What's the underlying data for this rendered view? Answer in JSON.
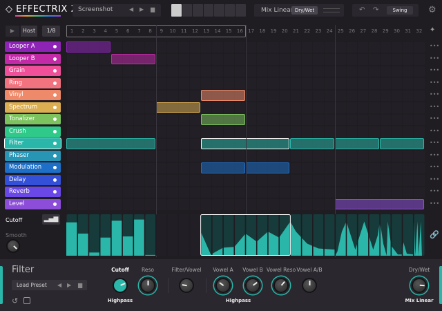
{
  "header": {
    "logo": "EFFECTRIX 2",
    "preset_name": "Screenshot",
    "mix_mode": "Mix Linear",
    "dry_wet_button": "Dry/Wet",
    "swing_button": "Swing"
  },
  "transport": {
    "play_icon": "play-icon",
    "sync": "Host",
    "rate": "1/8",
    "steps": [
      "1",
      "2",
      "3",
      "4",
      "5",
      "6",
      "7",
      "8",
      "9",
      "10",
      "11",
      "12",
      "13",
      "14",
      "15",
      "16",
      "17",
      "18",
      "19",
      "20",
      "21",
      "22",
      "23",
      "24",
      "25",
      "26",
      "27",
      "28",
      "29",
      "30",
      "31",
      "32"
    ],
    "loop_range": [
      1,
      16
    ]
  },
  "tracks": [
    {
      "name": "Looper A",
      "color": "#8e24b5",
      "blocks": [
        [
          1,
          4
        ]
      ]
    },
    {
      "name": "Looper B",
      "color": "#c22aa8",
      "blocks": [
        [
          5,
          8
        ]
      ]
    },
    {
      "name": "Grain",
      "color": "#f0509a",
      "blocks": []
    },
    {
      "name": "Ring",
      "color": "#f0737f",
      "blocks": []
    },
    {
      "name": "Vinyl",
      "color": "#ee8a6a",
      "blocks": [
        [
          13,
          16
        ]
      ]
    },
    {
      "name": "Spectrum",
      "color": "#dcae52",
      "blocks": [
        [
          9,
          12
        ]
      ]
    },
    {
      "name": "Tonalizer",
      "color": "#7cc25e",
      "blocks": [
        [
          13,
          16
        ]
      ]
    },
    {
      "name": "Crush",
      "color": "#2fc98a",
      "blocks": []
    },
    {
      "name": "Filter",
      "color": "#2ab7a9",
      "selected": true,
      "blocks": [
        [
          1,
          8
        ],
        [
          13,
          20
        ],
        [
          21,
          24
        ],
        [
          25,
          28
        ],
        [
          29,
          32
        ]
      ],
      "selected_block": 1
    },
    {
      "name": "Phaser",
      "color": "#2895b4",
      "blocks": []
    },
    {
      "name": "Modulation",
      "color": "#1d6fc8",
      "blocks": [
        [
          13,
          16
        ],
        [
          17,
          20
        ]
      ]
    },
    {
      "name": "Delay",
      "color": "#3450d8",
      "blocks": []
    },
    {
      "name": "Reverb",
      "color": "#6a48e8",
      "blocks": []
    },
    {
      "name": "Level",
      "color": "#8c4ed8",
      "blocks": [
        [
          25,
          32
        ]
      ]
    }
  ],
  "automation": {
    "parameter": "Cutoff",
    "smooth_label": "Smooth",
    "smooth_value": 0.7,
    "fill_color": "#2ab7a9",
    "selected_range": [
      13,
      20
    ],
    "points": [
      [
        0,
        0.83
      ],
      [
        1,
        0.83
      ],
      [
        1,
        0.55
      ],
      [
        2,
        0.55
      ],
      [
        2,
        0.08
      ],
      [
        3,
        0.08
      ],
      [
        3,
        0.45
      ],
      [
        4,
        0.45
      ],
      [
        4,
        0.87
      ],
      [
        5,
        0.87
      ],
      [
        5,
        0.48
      ],
      [
        6,
        0.48
      ],
      [
        6,
        0.9
      ],
      [
        7,
        0.9
      ],
      [
        7,
        0.02
      ],
      [
        8,
        0.02
      ],
      [
        8,
        0
      ],
      [
        12,
        0
      ],
      [
        12,
        0.6
      ],
      [
        12.9,
        0.03
      ],
      [
        14,
        0.2
      ],
      [
        15,
        0.22
      ],
      [
        16,
        0.55
      ],
      [
        17,
        0.35
      ],
      [
        18,
        0.6
      ],
      [
        19,
        0.45
      ],
      [
        20,
        0.85
      ],
      [
        20.5,
        0.6
      ],
      [
        21.5,
        0.3
      ],
      [
        22.5,
        0.18
      ],
      [
        24,
        0.15
      ],
      [
        24,
        0
      ],
      [
        24.2,
        0.1
      ],
      [
        24.6,
        0.6
      ],
      [
        25,
        0.85
      ],
      [
        25.4,
        0.5
      ],
      [
        25.8,
        0.15
      ],
      [
        26.2,
        0.5
      ],
      [
        26.6,
        0.85
      ],
      [
        27,
        0.5
      ],
      [
        27.4,
        0.15
      ],
      [
        27.8,
        0.5
      ],
      [
        28,
        0.85
      ],
      [
        28.3,
        0.3
      ],
      [
        28.6,
        0
      ],
      [
        28.7,
        0.85
      ],
      [
        29,
        0.25
      ],
      [
        29.6,
        0.03
      ],
      [
        30,
        0.03
      ],
      [
        30.1,
        0.33
      ],
      [
        30.4,
        0.05
      ],
      [
        31,
        0.03
      ],
      [
        31.05,
        0.85
      ],
      [
        31.15,
        0
      ],
      [
        31.35,
        0.85
      ],
      [
        31.45,
        0
      ],
      [
        31.65,
        0.85
      ],
      [
        31.75,
        0
      ],
      [
        32,
        0
      ]
    ]
  },
  "panel": {
    "title": "Filter",
    "load_preset": "Load Preset",
    "knobs": [
      {
        "label": "Cutoff",
        "value": 0.75,
        "active": true,
        "sub": "Highpass"
      },
      {
        "label": "Reso",
        "value": 0.5,
        "arc": 0.5
      },
      {
        "label": "Filter/Vowel",
        "value": 0.2
      },
      {
        "label": "Vowel A",
        "value": 0.3,
        "arc": 0.1
      },
      {
        "label": "Vowel B",
        "value": 0.7,
        "arc": 0.6,
        "sub": "Highpass"
      },
      {
        "label": "Vowel Reso",
        "value": 0.65,
        "arc": 0.65
      },
      {
        "label": "Vowel A/B",
        "value": 0.5
      },
      {
        "label": "Dry/Wet",
        "value": 0.85,
        "arc": 0.85,
        "sub": "Mix Linear"
      }
    ]
  }
}
